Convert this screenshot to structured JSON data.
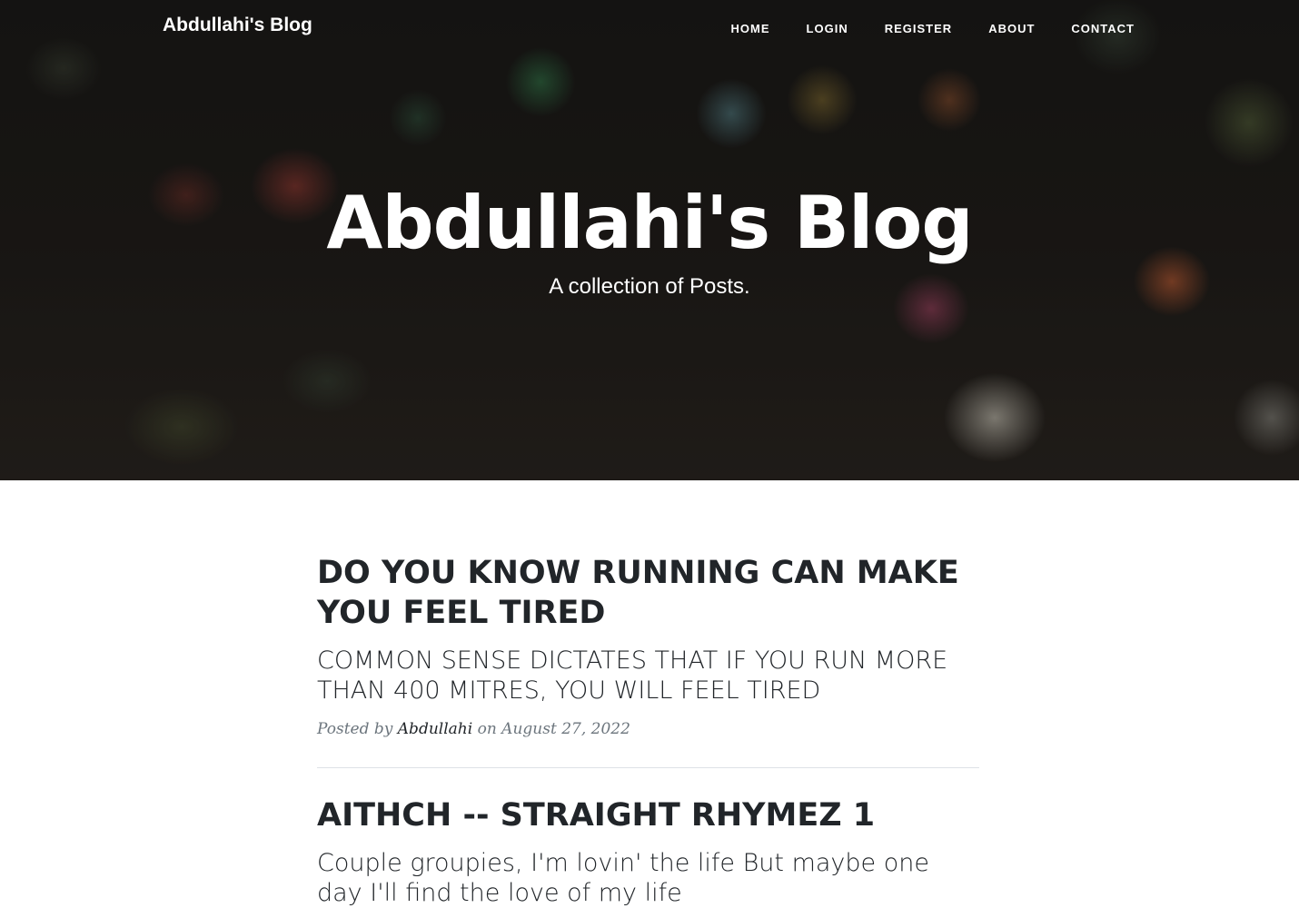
{
  "navbar": {
    "brand": "Abdullahi's Blog",
    "links": [
      "HOME",
      "LOGIN",
      "REGISTER",
      "ABOUT",
      "CONTACT"
    ]
  },
  "hero": {
    "title": "Abdullahi's Blog",
    "subtitle": "A collection of Posts."
  },
  "posts": [
    {
      "title": "DO YOU KNOW RUNNING CAN MAKE YOU FEEL TIRED",
      "subtitle": "COMMON SENSE DICTATES THAT IF YOU RUN MORE THAN 400 MITRES, YOU WILL FEEL TIRED",
      "meta_prefix": "Posted by",
      "author": "Abdullahi",
      "meta_on": "on",
      "date": "August 27, 2022"
    },
    {
      "title": "AITHCH -- STRAIGHT RHYMEZ 1",
      "subtitle": "Couple groupies, I'm lovin' the life But maybe one day I'll find the love of my life"
    }
  ]
}
